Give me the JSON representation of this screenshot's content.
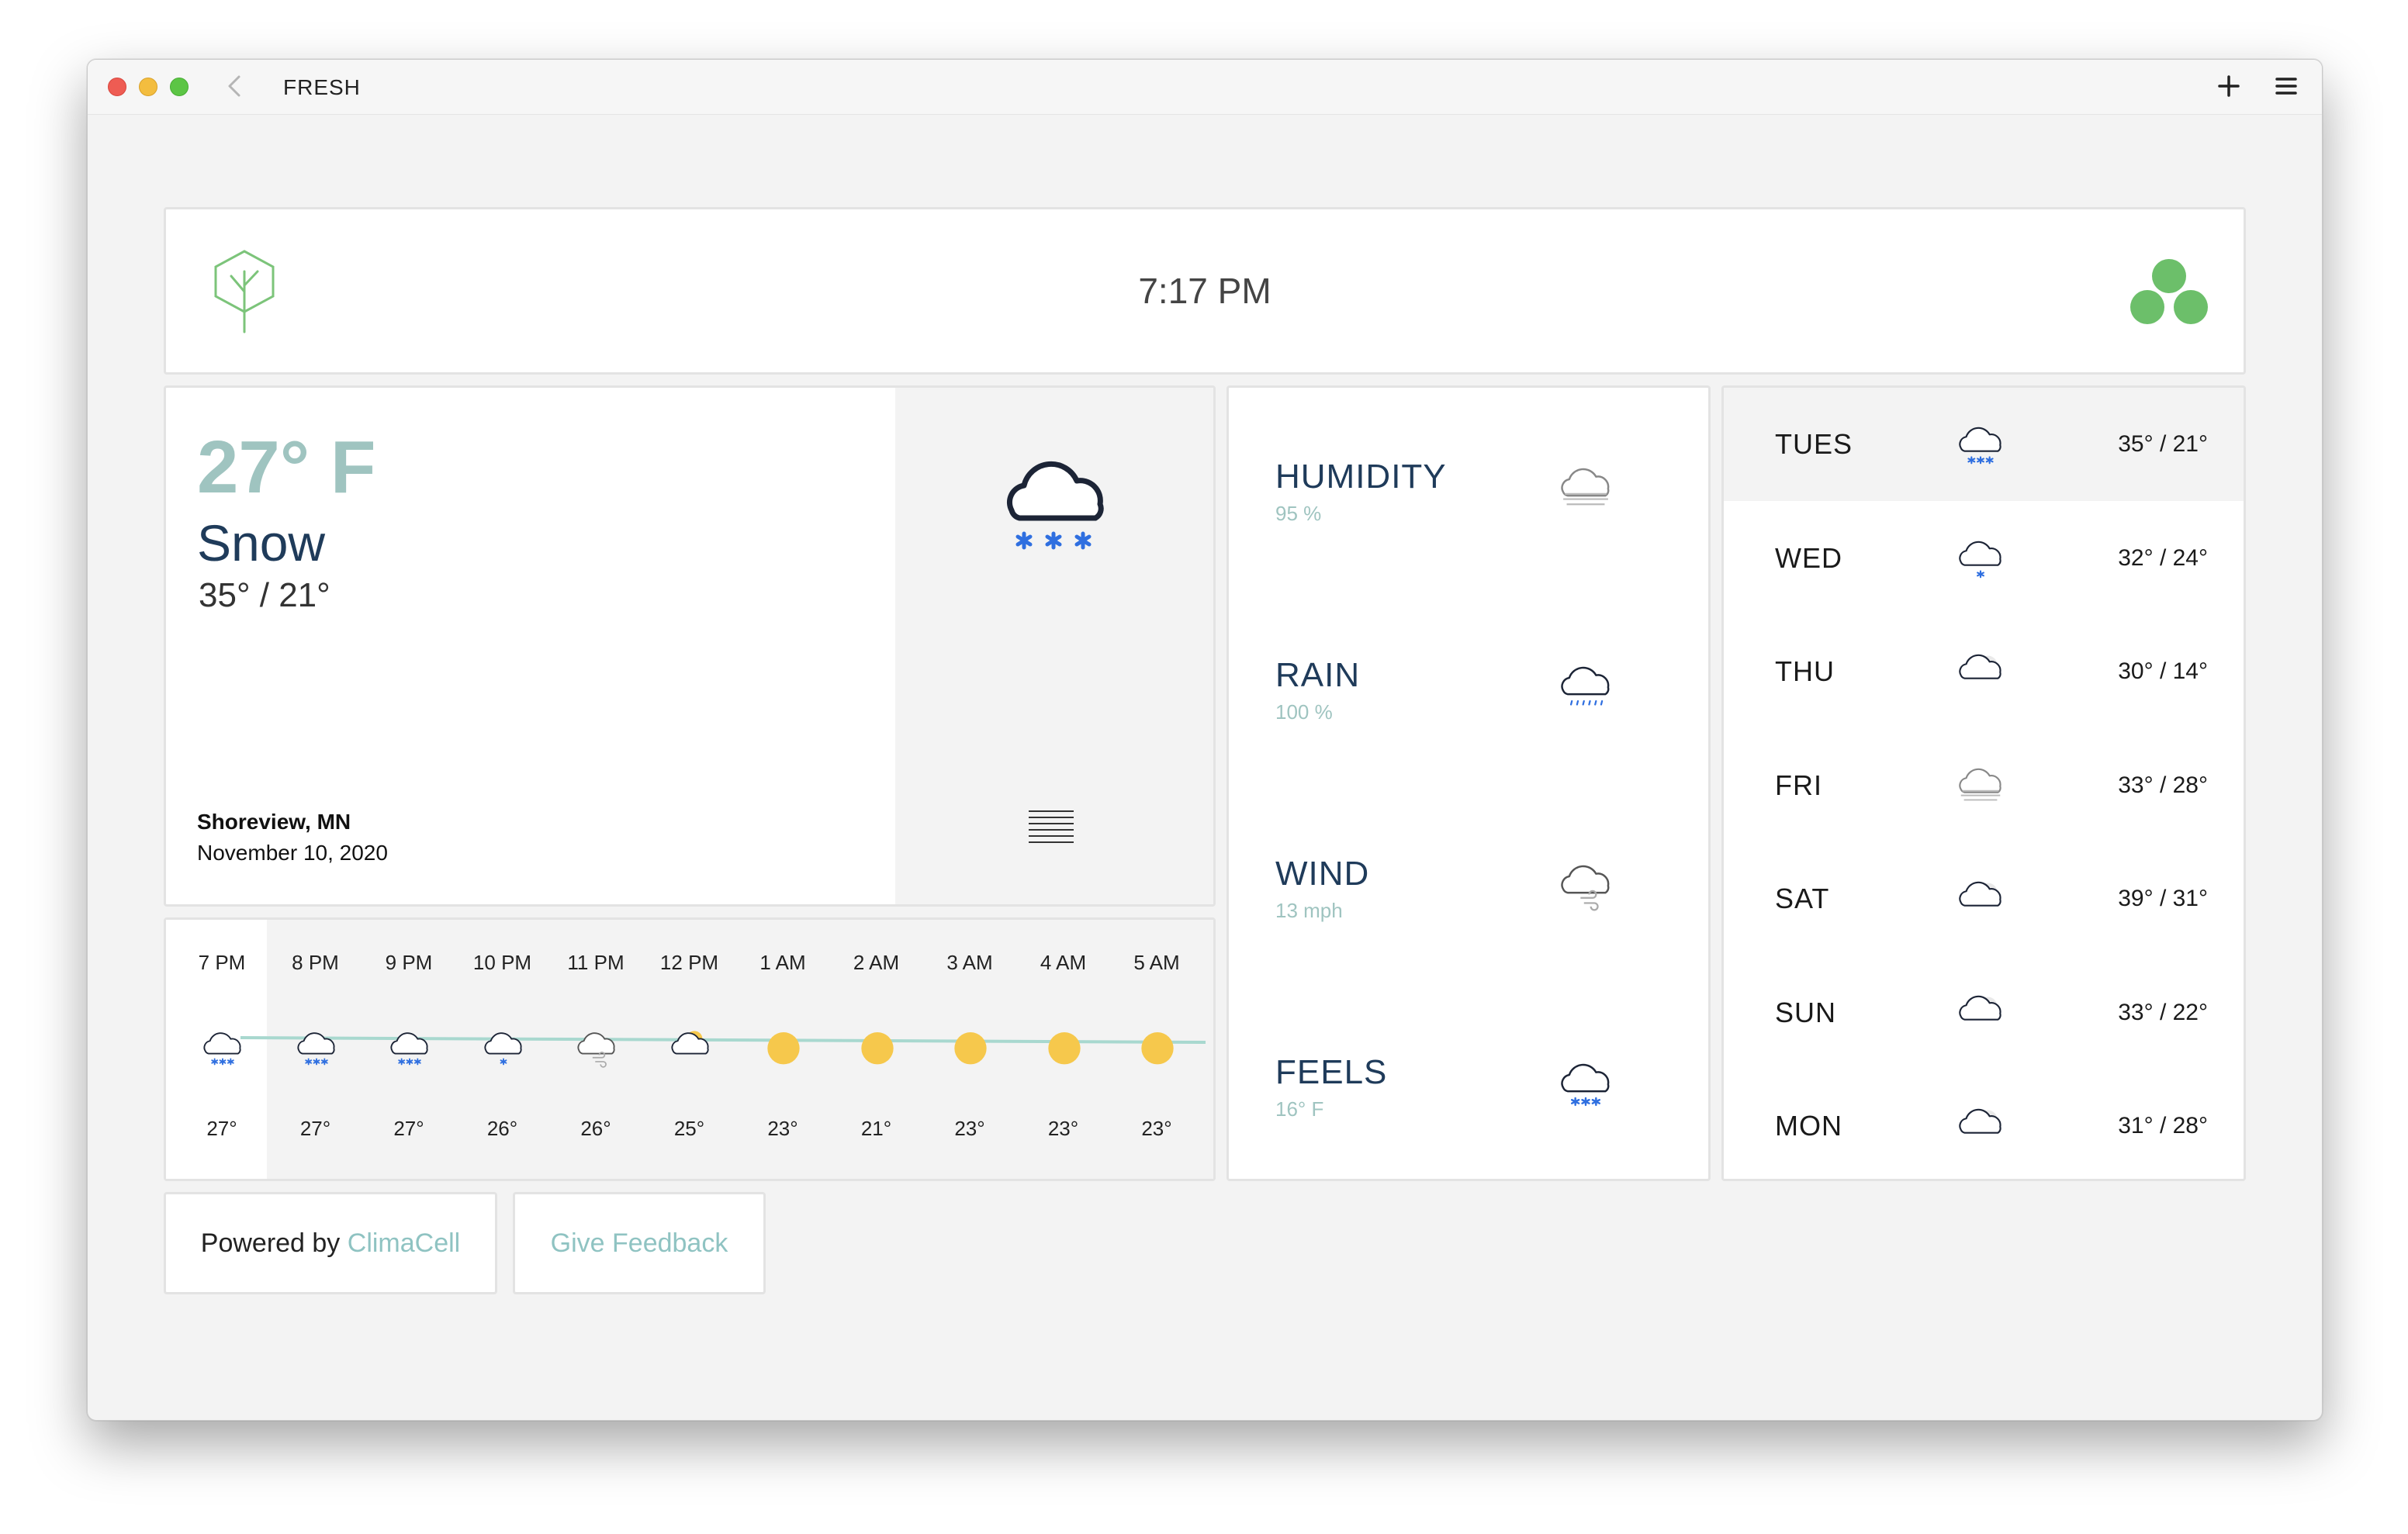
{
  "window": {
    "title": "FRESH",
    "back_icon": "chevron-left-icon",
    "add_icon": "plus-icon",
    "menu_icon": "hamburger-menu-icon"
  },
  "header": {
    "logo_icon": "tree-hexagon-logo-icon",
    "time": "7:17 PM",
    "status_icon": "three-dots-cluster-icon"
  },
  "current": {
    "temperature": "27° F",
    "condition": "Snow",
    "high_low": "35° / 21°",
    "location": "Shoreview, MN",
    "date": "November 10, 2020",
    "icon": "snow-cloud-icon",
    "details_icon": "lines-icon"
  },
  "hourly": [
    {
      "time": "7 PM",
      "temp": "27°",
      "icon": "snow-icon"
    },
    {
      "time": "8 PM",
      "temp": "27°",
      "icon": "snow-icon"
    },
    {
      "time": "9 PM",
      "temp": "27°",
      "icon": "snow-icon"
    },
    {
      "time": "10 PM",
      "temp": "26°",
      "icon": "flurries-icon"
    },
    {
      "time": "11 PM",
      "temp": "26°",
      "icon": "wind-cloud-icon"
    },
    {
      "time": "12 PM",
      "temp": "25°",
      "icon": "partly-cloudy-icon"
    },
    {
      "time": "1 AM",
      "temp": "23°",
      "icon": "sun-icon"
    },
    {
      "time": "2 AM",
      "temp": "21°",
      "icon": "sun-icon"
    },
    {
      "time": "3 AM",
      "temp": "23°",
      "icon": "sun-icon"
    },
    {
      "time": "4 AM",
      "temp": "23°",
      "icon": "sun-icon"
    },
    {
      "time": "5 AM",
      "temp": "23°",
      "icon": "sun-icon"
    }
  ],
  "details": [
    {
      "label": "HUMIDITY",
      "value": "95 %",
      "icon": "fog-cloud-icon"
    },
    {
      "label": "RAIN",
      "value": "100 %",
      "icon": "drizzle-cloud-icon"
    },
    {
      "label": "WIND",
      "value": "13 mph",
      "icon": "wind-cloud-icon"
    },
    {
      "label": "FEELS",
      "value": "16° F",
      "icon": "snow-cloud-icon"
    }
  ],
  "forecast": [
    {
      "day": "TUES",
      "temps": "35° / 21°",
      "icon": "snow-icon"
    },
    {
      "day": "WED",
      "temps": "32° / 24°",
      "icon": "flurries-icon"
    },
    {
      "day": "THU",
      "temps": "30° / 14°",
      "icon": "cloudy-icon"
    },
    {
      "day": "FRI",
      "temps": "33° / 28°",
      "icon": "fog-icon"
    },
    {
      "day": "SAT",
      "temps": "39° / 31°",
      "icon": "cloudy-icon"
    },
    {
      "day": "SUN",
      "temps": "33° / 22°",
      "icon": "cloudy-icon"
    },
    {
      "day": "MON",
      "temps": "31° / 28°",
      "icon": "cloudy-icon"
    }
  ],
  "footer": {
    "powered_prefix": "Powered by ",
    "powered_brand": "ClimaCell",
    "feedback": "Give Feedback"
  },
  "colors": {
    "accent_teal": "#9fc4c0",
    "heading_navy": "#1f3b5a",
    "snow_blue": "#2f6fe0",
    "sun_yellow": "#f6c84c",
    "logo_green": "#6cbf6a"
  }
}
